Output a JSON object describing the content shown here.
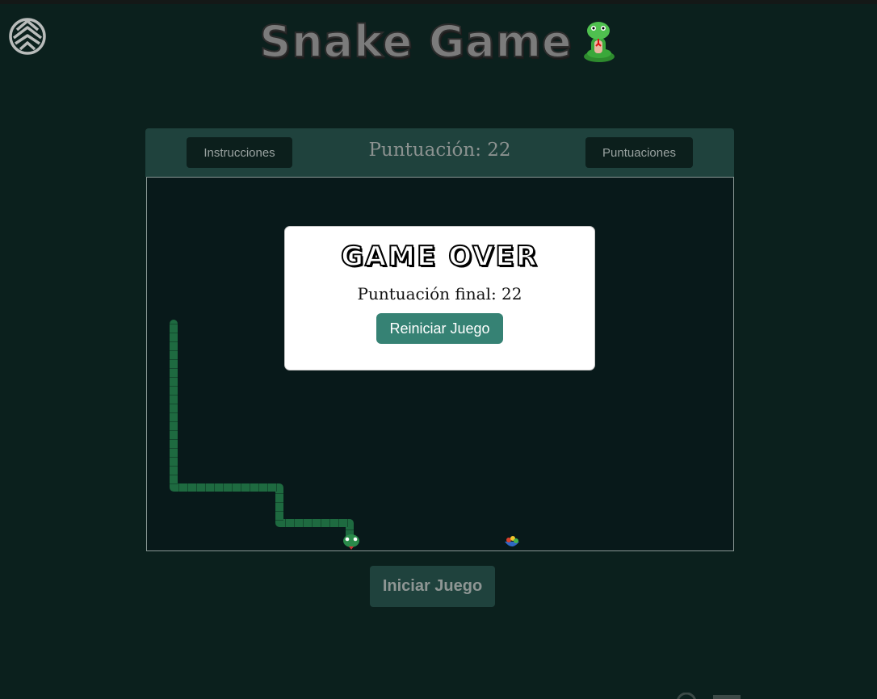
{
  "header": {
    "title": "Snake Game",
    "title_emoji": "snake-emoji-icon",
    "logo": "triangle-circle-logo-icon"
  },
  "toolbar": {
    "instructions_label": "Instrucciones",
    "score_label": "Puntuación: 22",
    "scores_label": "Puntuaciones"
  },
  "game": {
    "score": 22,
    "snake_color": "#1e6a40",
    "board_color": "#08191a"
  },
  "modal": {
    "title": "GAME OVER",
    "final_score_text": "Puntuación final: 22",
    "restart_label": "Reiniciar Juego"
  },
  "footer": {
    "start_label": "Iniciar Juego"
  },
  "colors": {
    "background": "#0b201d",
    "panel_header": "#1f423d",
    "accent": "#368274"
  }
}
